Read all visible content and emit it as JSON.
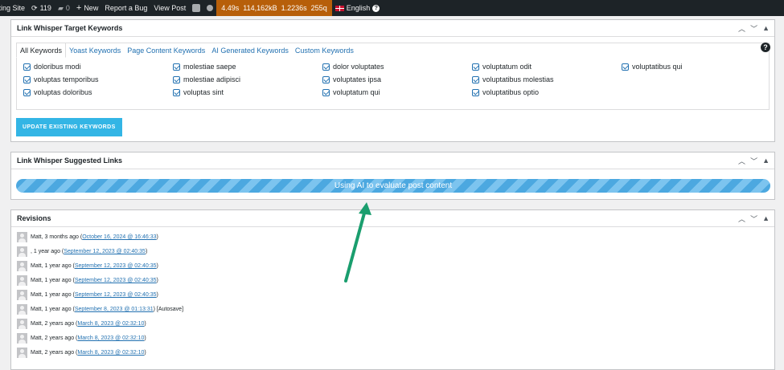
{
  "adminbar": {
    "site_name": "sting Site",
    "updates_count": "119",
    "comments_count": "0",
    "new_label": "New",
    "report_bug": "Report a Bug",
    "view_post": "View Post",
    "qm_time": "4.49s",
    "qm_memory": "114,162kB",
    "qm_db_time": "1.2236s",
    "qm_queries": "255q",
    "language": "English",
    "qm_color": "#b75f0a"
  },
  "target_keywords": {
    "title": "Link Whisper Target Keywords",
    "tabs": [
      "All Keywords",
      "Yoast Keywords",
      "Page Content Keywords",
      "AI Generated Keywords",
      "Custom Keywords"
    ],
    "keywords": [
      "doloribus modi",
      "molestiae saepe",
      "dolor voluptates",
      "voluptatum odit",
      "voluptatibus qui",
      "voluptas temporibus",
      "molestiae adipisci",
      "voluptates ipsa",
      "voluptatibus molestias",
      "voluptas doloribus",
      "voluptas sint",
      "voluptatum qui",
      "voluptatibus optio"
    ],
    "update_button": "UPDATE EXISTING KEYWORDS",
    "help": "?"
  },
  "suggested_links": {
    "title": "Link Whisper Suggested Links",
    "progress_text": "Using AI to evaluate post content"
  },
  "revisions": {
    "title": "Revisions",
    "items": [
      {
        "author": "Matt, 3 months ago (",
        "link": "October 16, 2024 @ 16:46:33",
        "suffix": ")"
      },
      {
        "author": ", 1 year ago (",
        "link": "September 12, 2023 @ 02:40:35",
        "suffix": ")"
      },
      {
        "author": "Matt, 1 year ago (",
        "link": "September 12, 2023 @ 02:40:35",
        "suffix": ")"
      },
      {
        "author": "Matt, 1 year ago (",
        "link": "September 12, 2023 @ 02:40:35",
        "suffix": ")"
      },
      {
        "author": "Matt, 1 year ago (",
        "link": "September 12, 2023 @ 02:40:35",
        "suffix": ")"
      },
      {
        "author": "Matt, 1 year ago (",
        "link": "September 8, 2023 @ 01:13:31",
        "suffix": ") [Autosave]"
      },
      {
        "author": "Matt, 2 years ago (",
        "link": "March 8, 2023 @ 02:32:10",
        "suffix": ")"
      },
      {
        "author": "Matt, 2 years ago (",
        "link": "March 8, 2023 @ 02:32:10",
        "suffix": ")"
      },
      {
        "author": "Matt, 2 years ago (",
        "link": "March 8, 2023 @ 02:32:10",
        "suffix": ")"
      }
    ]
  },
  "colors": {
    "button": "#33b5e5",
    "progress": "#4ca8e0",
    "arrow": "#1a9e6e",
    "link": "#2271b1"
  }
}
